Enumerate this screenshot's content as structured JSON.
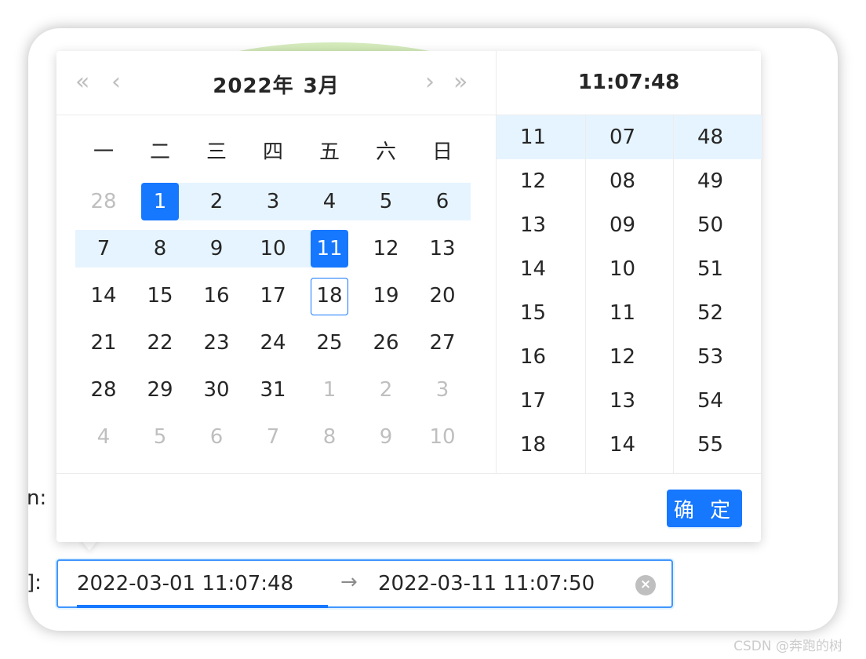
{
  "form": {
    "label_upper": "n:",
    "label_lower": "]:"
  },
  "picker": {
    "nav": {
      "super_prev": "«",
      "prev": "‹",
      "next": "›",
      "super_next": "»"
    },
    "year_label": "2022年",
    "month_label": "3月",
    "weekdays": [
      "一",
      "二",
      "三",
      "四",
      "五",
      "六",
      "日"
    ],
    "weeks": [
      [
        {
          "d": "28",
          "muted": true
        },
        {
          "d": "1",
          "state": "selected"
        },
        {
          "d": "2",
          "state": "in-range"
        },
        {
          "d": "3",
          "state": "in-range"
        },
        {
          "d": "4",
          "state": "in-range"
        },
        {
          "d": "5",
          "state": "in-range"
        },
        {
          "d": "6",
          "state": "in-range"
        }
      ],
      [
        {
          "d": "7",
          "state": "in-range"
        },
        {
          "d": "8",
          "state": "in-range"
        },
        {
          "d": "9",
          "state": "in-range"
        },
        {
          "d": "10",
          "state": "in-range"
        },
        {
          "d": "11",
          "state": "selected"
        },
        {
          "d": "12"
        },
        {
          "d": "13"
        }
      ],
      [
        {
          "d": "14"
        },
        {
          "d": "15"
        },
        {
          "d": "16"
        },
        {
          "d": "17"
        },
        {
          "d": "18",
          "state": "today"
        },
        {
          "d": "19"
        },
        {
          "d": "20"
        }
      ],
      [
        {
          "d": "21"
        },
        {
          "d": "22"
        },
        {
          "d": "23"
        },
        {
          "d": "24"
        },
        {
          "d": "25"
        },
        {
          "d": "26"
        },
        {
          "d": "27"
        }
      ],
      [
        {
          "d": "28"
        },
        {
          "d": "29"
        },
        {
          "d": "30"
        },
        {
          "d": "31"
        },
        {
          "d": "1",
          "muted": true
        },
        {
          "d": "2",
          "muted": true
        },
        {
          "d": "3",
          "muted": true
        }
      ],
      [
        {
          "d": "4",
          "muted": true
        },
        {
          "d": "5",
          "muted": true
        },
        {
          "d": "6",
          "muted": true
        },
        {
          "d": "7",
          "muted": true
        },
        {
          "d": "8",
          "muted": true
        },
        {
          "d": "9",
          "muted": true
        },
        {
          "d": "10",
          "muted": true
        }
      ]
    ],
    "time_header": "11:07:48",
    "hours": [
      "11",
      "12",
      "13",
      "14",
      "15",
      "16",
      "17",
      "18"
    ],
    "minutes": [
      "07",
      "08",
      "09",
      "10",
      "11",
      "12",
      "13",
      "14"
    ],
    "seconds": [
      "48",
      "49",
      "50",
      "51",
      "52",
      "53",
      "54",
      "55"
    ],
    "selected_hour": "11",
    "selected_minute": "07",
    "selected_second": "48",
    "ok_label": "确 定"
  },
  "range_input": {
    "start": "2022-03-01 11:07:48",
    "separator": "→",
    "end": "2022-03-11 11:07:50",
    "clear_icon": "×"
  },
  "watermark": "CSDN @奔跑的树",
  "colors": {
    "primary": "#1677ff",
    "range_bg": "#e6f4ff",
    "muted": "#bfbfbf"
  }
}
